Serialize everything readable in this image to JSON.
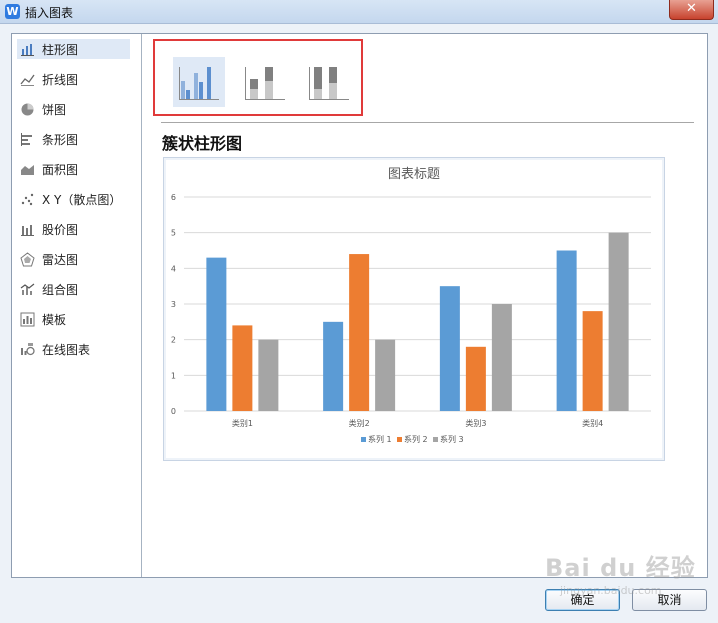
{
  "window": {
    "title": "插入图表",
    "close_label": "✕",
    "logo_letter": "W"
  },
  "sidebar": {
    "items": [
      {
        "label": "柱形图",
        "icon": "column-chart-icon",
        "selected": true
      },
      {
        "label": "折线图",
        "icon": "line-chart-icon"
      },
      {
        "label": "饼图",
        "icon": "pie-chart-icon"
      },
      {
        "label": "条形图",
        "icon": "bar-chart-icon"
      },
      {
        "label": "面积图",
        "icon": "area-chart-icon"
      },
      {
        "label": "X Y（散点图）",
        "icon": "scatter-chart-icon"
      },
      {
        "label": "股价图",
        "icon": "stock-chart-icon"
      },
      {
        "label": "雷达图",
        "icon": "radar-chart-icon"
      },
      {
        "label": "组合图",
        "icon": "combo-chart-icon"
      },
      {
        "label": "模板",
        "icon": "template-icon"
      },
      {
        "label": "在线图表",
        "icon": "online-chart-icon"
      }
    ]
  },
  "subtypes": [
    {
      "name": "clustered-column-thumbnail",
      "selected": true
    },
    {
      "name": "stacked-column-thumbnail"
    },
    {
      "name": "percent-stacked-column-thumbnail"
    }
  ],
  "preview": {
    "heading": "簇状柱形图"
  },
  "chart_data": {
    "type": "bar",
    "title": "图表标题",
    "categories": [
      "类别1",
      "类别2",
      "类别3",
      "类别4"
    ],
    "series": [
      {
        "name": "系列 1",
        "values": [
          4.3,
          2.5,
          3.5,
          4.5
        ],
        "color": "#5b9bd5"
      },
      {
        "name": "系列 2",
        "values": [
          2.4,
          4.4,
          1.8,
          2.8
        ],
        "color": "#ed7d31"
      },
      {
        "name": "系列 3",
        "values": [
          2,
          2,
          3,
          5
        ],
        "color": "#a5a5a5"
      }
    ],
    "yticks": [
      "0",
      "1",
      "2",
      "3",
      "4",
      "5",
      "6"
    ],
    "ylim": [
      0,
      6
    ],
    "grid": true,
    "legend": "bottom",
    "xlabel": "",
    "ylabel": ""
  },
  "buttons": {
    "ok": "确定",
    "cancel": "取消"
  },
  "watermark": {
    "text": "Bai du 经验",
    "url": "jingyan.baidu.com"
  }
}
